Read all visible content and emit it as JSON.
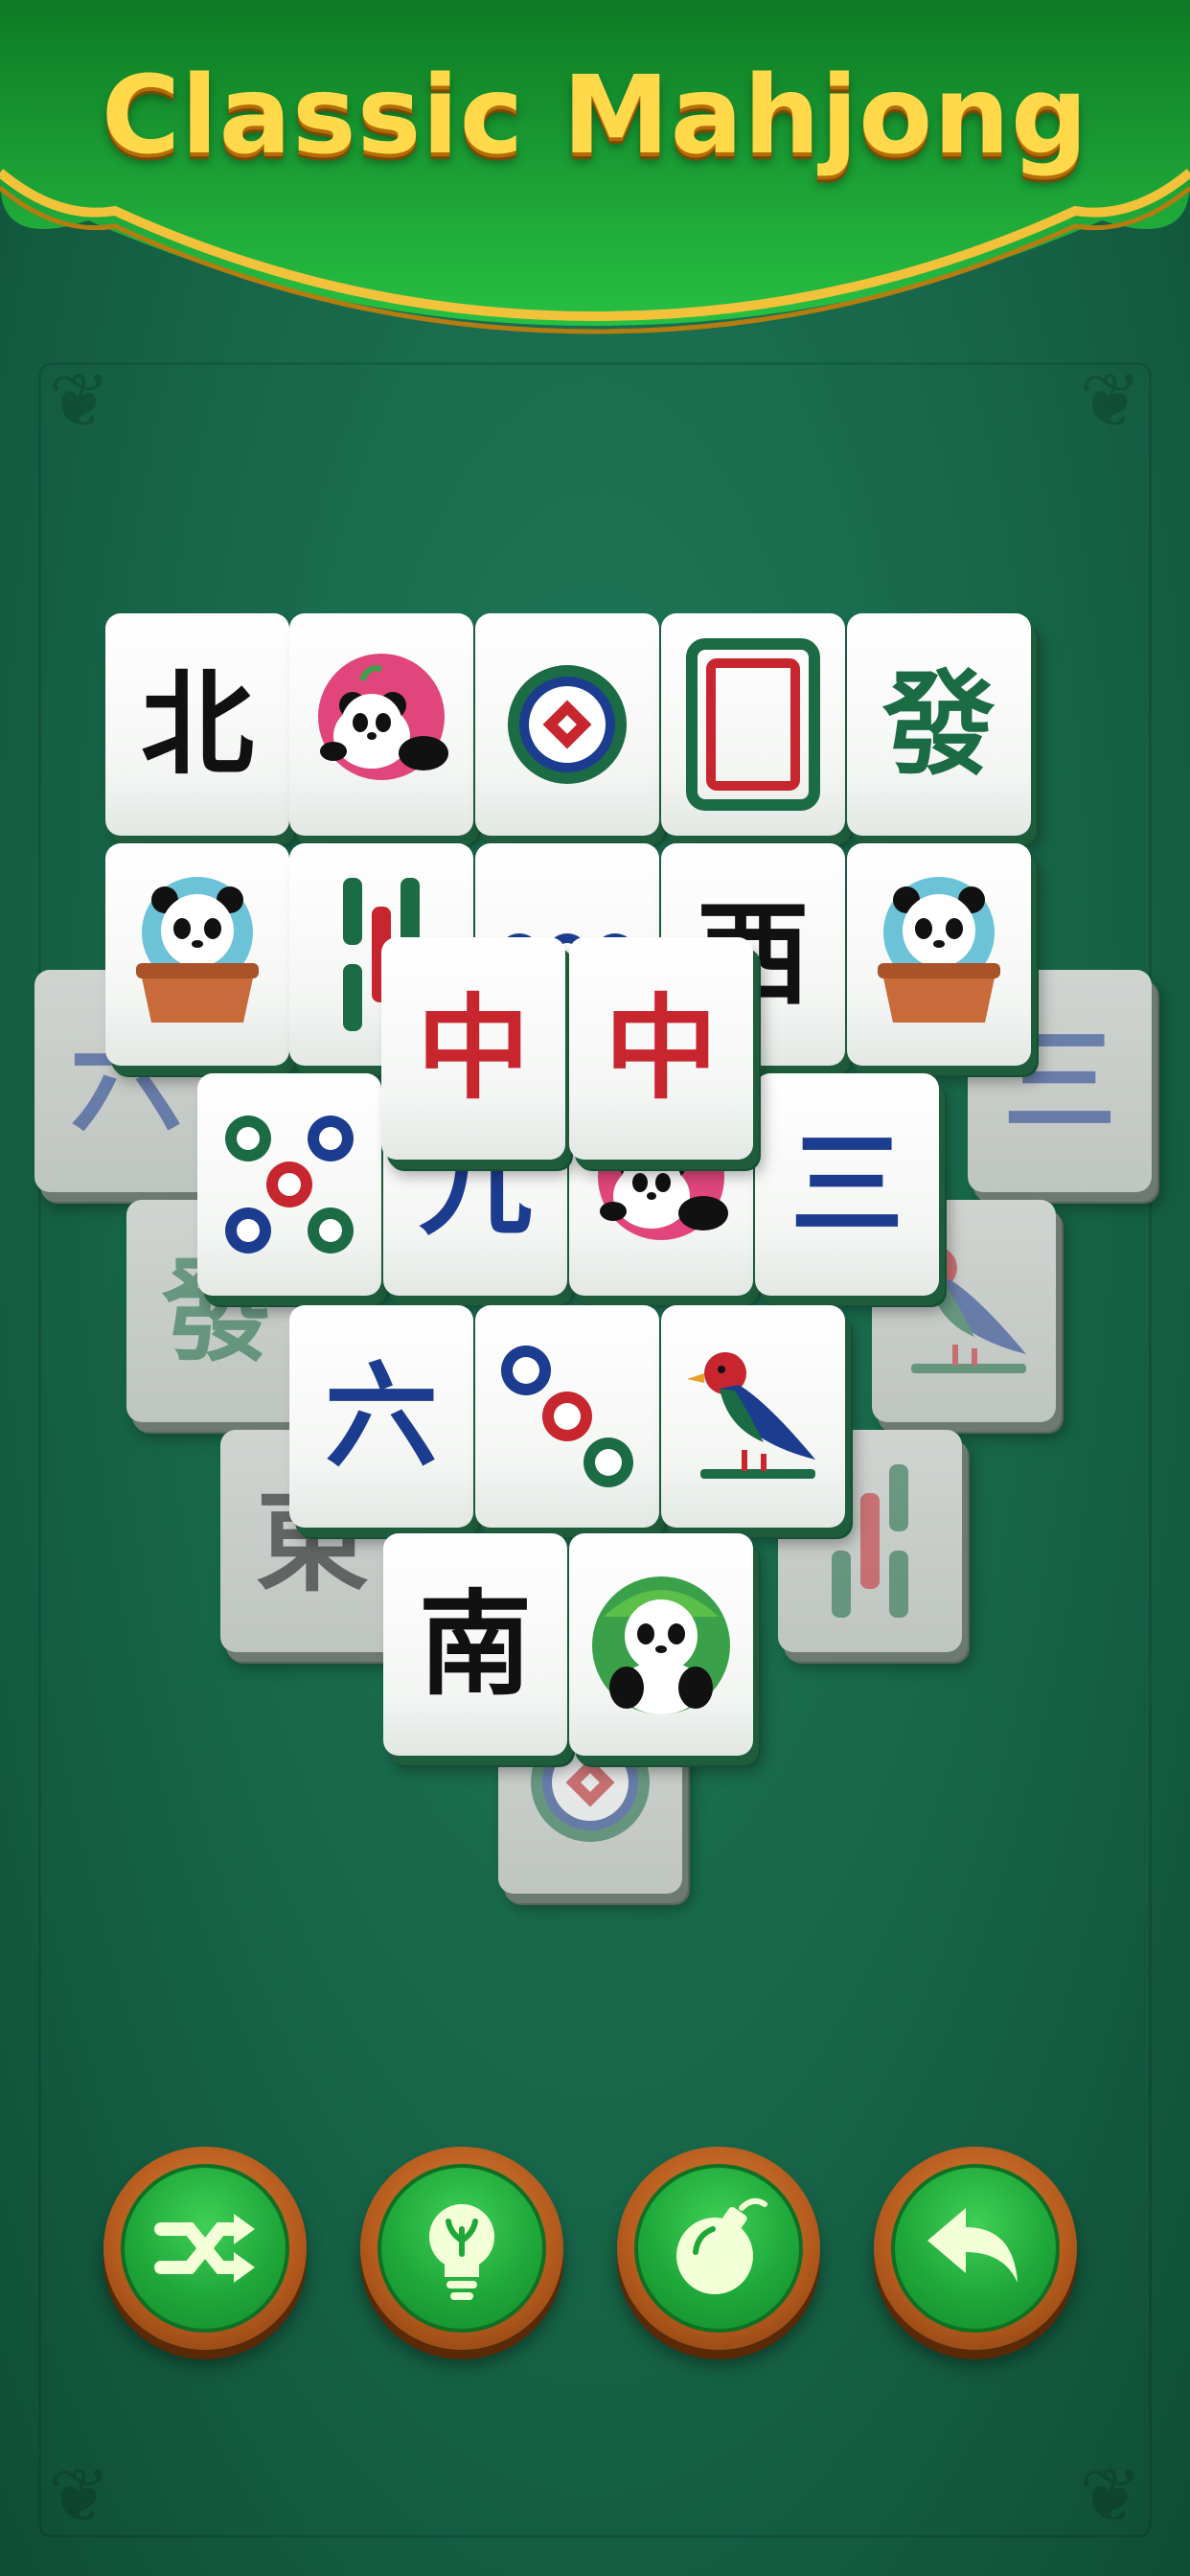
{
  "game": {
    "title": "Classic Mahjong"
  },
  "colors": {
    "felt": "#176548",
    "banner": "#1ea53a",
    "gold": "#ffd94a",
    "tile": "#ffffff",
    "red": "#c8262e",
    "blue": "#1c3c8f",
    "green": "#1b6b44"
  },
  "tiles": [
    {
      "id": "t-north",
      "kind": "char",
      "text": "北",
      "color": "#111111",
      "dim": false
    },
    {
      "id": "t-panda-pink",
      "kind": "icon",
      "icon": "panda-pink-icon",
      "dim": false
    },
    {
      "id": "t-dot-one-a",
      "kind": "icon",
      "icon": "one-dot-icon",
      "dim": false
    },
    {
      "id": "t-white-dragon",
      "kind": "icon",
      "icon": "white-dragon-icon",
      "dim": false
    },
    {
      "id": "t-fa-a",
      "kind": "char",
      "text": "發",
      "color": "#1b6b44",
      "dim": false
    },
    {
      "id": "t-panda-pot-a",
      "kind": "icon",
      "icon": "panda-pot-icon",
      "dim": false
    },
    {
      "id": "t-bamboo-a",
      "kind": "icon",
      "icon": "bamboo-icon",
      "dim": false
    },
    {
      "id": "t-three-dots",
      "kind": "icon",
      "icon": "three-dots-icon",
      "dim": false
    },
    {
      "id": "t-west",
      "kind": "char",
      "text": "西",
      "color": "#111111",
      "dim": false
    },
    {
      "id": "t-panda-pot-b",
      "kind": "icon",
      "icon": "panda-pot-icon",
      "dim": false
    },
    {
      "id": "t-six-char-dim",
      "kind": "char",
      "text": "六",
      "color": "#1c3c8f",
      "dim": true
    },
    {
      "id": "t-three-char-dim",
      "kind": "char",
      "text": "三",
      "color": "#1c3c8f",
      "dim": true
    },
    {
      "id": "t-fa-dim",
      "kind": "char",
      "text": "發",
      "color": "#1b6b44",
      "dim": true
    },
    {
      "id": "t-bird-dim",
      "kind": "icon",
      "icon": "bird-icon",
      "dim": true
    },
    {
      "id": "t-east-dim",
      "kind": "char",
      "text": "東",
      "color": "#111111",
      "dim": true
    },
    {
      "id": "t-bamboo-dim",
      "kind": "icon",
      "icon": "bamboo-icon",
      "dim": true
    },
    {
      "id": "t-one-dot-dim",
      "kind": "icon",
      "icon": "one-dot-icon",
      "dim": true
    },
    {
      "id": "t-five-dots",
      "kind": "icon",
      "icon": "five-dots-icon",
      "dim": false
    },
    {
      "id": "t-nine-char",
      "kind": "char",
      "text": "九",
      "color": "#1c3c8f",
      "dim": false
    },
    {
      "id": "t-panda-pink-b",
      "kind": "icon",
      "icon": "panda-pink-icon",
      "dim": false
    },
    {
      "id": "t-three-char",
      "kind": "char",
      "text": "三",
      "color": "#1c3c8f",
      "dim": false
    },
    {
      "id": "t-zhong-a",
      "kind": "char",
      "text": "中",
      "color": "#c8262e",
      "dim": false
    },
    {
      "id": "t-zhong-b",
      "kind": "char",
      "text": "中",
      "color": "#c8262e",
      "dim": false
    },
    {
      "id": "t-six-char",
      "kind": "char",
      "text": "六",
      "color": "#1c3c8f",
      "dim": false
    },
    {
      "id": "t-three-dots-diag",
      "kind": "icon",
      "icon": "three-dots-diag-icon",
      "dim": false
    },
    {
      "id": "t-bird",
      "kind": "icon",
      "icon": "bird-icon",
      "dim": false
    },
    {
      "id": "t-south",
      "kind": "char",
      "text": "南",
      "color": "#111111",
      "dim": false
    },
    {
      "id": "t-panda-green",
      "kind": "icon",
      "icon": "panda-green-icon",
      "dim": false
    }
  ],
  "controls": [
    {
      "id": "shuffle",
      "icon": "shuffle-icon"
    },
    {
      "id": "hint",
      "icon": "lightbulb-icon"
    },
    {
      "id": "bomb",
      "icon": "bomb-icon"
    },
    {
      "id": "undo",
      "icon": "undo-icon"
    }
  ]
}
